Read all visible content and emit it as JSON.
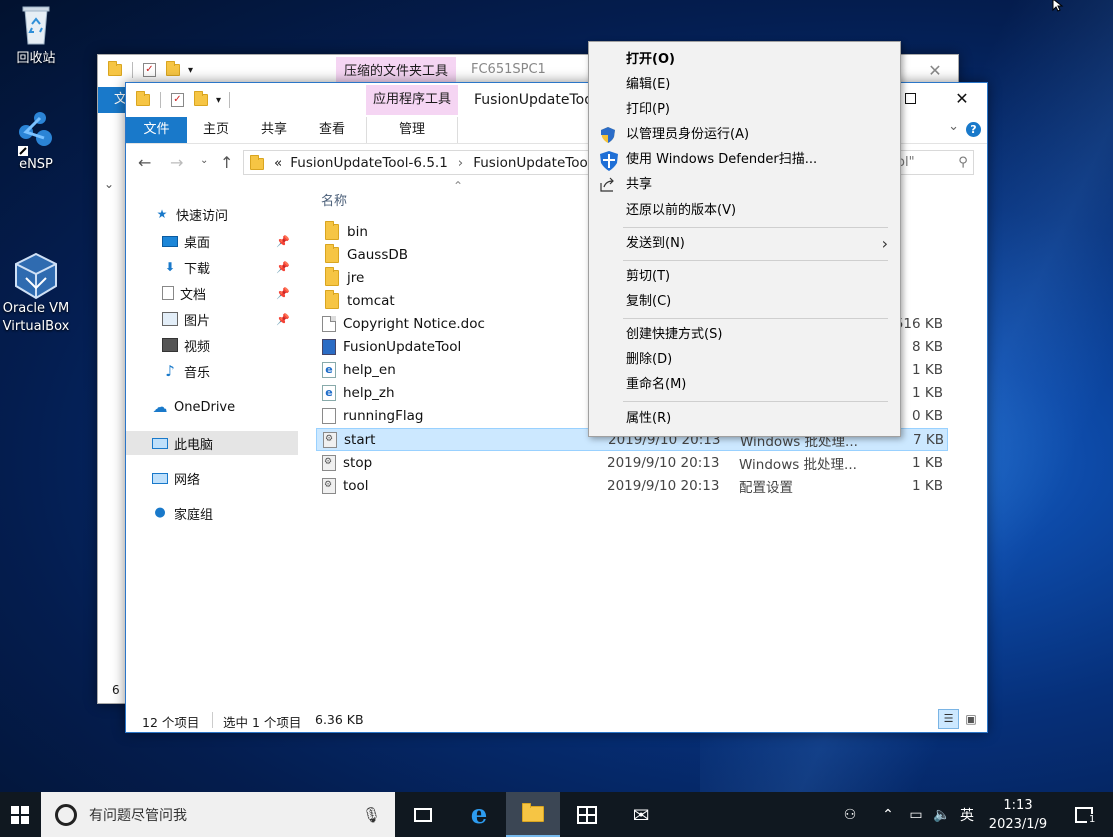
{
  "desktop": {
    "icons": [
      {
        "label": "回收站"
      },
      {
        "label": "eNSP"
      },
      {
        "label": "Oracle VM\nVirtualBox"
      }
    ]
  },
  "back_window": {
    "context_tab": "压缩的文件夹工具",
    "title": "FC651SPC1",
    "file_tab": "文",
    "status_left": "6"
  },
  "front_window": {
    "context_tab": "应用程序工具",
    "title": "FusionUpdateTool",
    "tabs": [
      "文件",
      "主页",
      "共享",
      "查看",
      "管理"
    ],
    "address": {
      "prefix": "«",
      "parts": [
        "FusionUpdateTool-6.5.1",
        "FusionUpdateTool"
      ],
      "separator": "›"
    },
    "search_placeholder": "ol\"",
    "column_name": "名称",
    "sidebar": [
      {
        "label": "快速访问",
        "icon": "star-icon"
      },
      {
        "label": "桌面",
        "icon": "desktop-icon",
        "pinned": true
      },
      {
        "label": "下载",
        "icon": "download-icon",
        "pinned": true
      },
      {
        "label": "文档",
        "icon": "document-icon",
        "pinned": true
      },
      {
        "label": "图片",
        "icon": "picture-icon",
        "pinned": true
      },
      {
        "label": "视频",
        "icon": "video-icon"
      },
      {
        "label": "音乐",
        "icon": "music-icon"
      },
      {
        "label": "OneDrive",
        "icon": "cloud-icon"
      },
      {
        "label": "此电脑",
        "icon": "computer-icon",
        "selected": true
      },
      {
        "label": "网络",
        "icon": "network-icon"
      },
      {
        "label": "家庭组",
        "icon": "homegroup-icon"
      }
    ],
    "files": [
      {
        "name": "bin",
        "kind": "folder",
        "date": "",
        "type": "",
        "size": ""
      },
      {
        "name": "GaussDB",
        "kind": "folder",
        "date": "",
        "type": "",
        "size": ""
      },
      {
        "name": "jre",
        "kind": "folder",
        "date": "",
        "type": "",
        "size": ""
      },
      {
        "name": "tomcat",
        "kind": "folder",
        "date": "",
        "type": "",
        "size": ""
      },
      {
        "name": "Copyright Notice.doc",
        "kind": "doc",
        "date": "",
        "type": "",
        "size": "516 KB"
      },
      {
        "name": "FusionUpdateTool",
        "kind": "app",
        "date": "",
        "type": "",
        "size": "8 KB"
      },
      {
        "name": "help_en",
        "kind": "html",
        "date": "",
        "type": "",
        "size": "1 KB"
      },
      {
        "name": "help_zh",
        "kind": "html",
        "date": "",
        "type": "",
        "size": "1 KB"
      },
      {
        "name": "runningFlag",
        "kind": "file",
        "date": "",
        "type": "",
        "size": "0 KB"
      },
      {
        "name": "start",
        "kind": "bat",
        "date": "2019/9/10 20:13",
        "type": "Windows 批处理...",
        "size": "7 KB",
        "selected": true
      },
      {
        "name": "stop",
        "kind": "bat",
        "date": "2019/9/10 20:13",
        "type": "Windows 批处理...",
        "size": "1 KB"
      },
      {
        "name": "tool",
        "kind": "config",
        "date": "2019/9/10 20:13",
        "type": "配置设置",
        "size": "1 KB"
      }
    ],
    "status": {
      "count": "12 个项目",
      "selected": "选中 1 个项目",
      "size": "6.36 KB"
    }
  },
  "context_menu": {
    "items": [
      {
        "label": "打开(O)",
        "bold": true
      },
      {
        "label": "编辑(E)"
      },
      {
        "label": "打印(P)"
      },
      {
        "label": "以管理员身份运行(A)",
        "icon": "uac-shield-icon"
      },
      {
        "label": "使用 Windows Defender扫描...",
        "icon": "defender-icon"
      },
      {
        "label": "共享",
        "icon": "share-icon"
      },
      {
        "label": "还原以前的版本(V)"
      },
      {
        "label": "发送到(N)",
        "submenu": true
      },
      {
        "label": "剪切(T)"
      },
      {
        "label": "复制(C)"
      },
      {
        "label": "创建快捷方式(S)"
      },
      {
        "label": "删除(D)"
      },
      {
        "label": "重命名(M)"
      },
      {
        "label": "属性(R)"
      }
    ]
  },
  "taskbar": {
    "search_placeholder": "有问题尽管问我",
    "ime": "英",
    "time": "1:13",
    "date": "2023/1/9",
    "notification_count": "1"
  },
  "colors": {
    "accent": "#1979ca",
    "selection": "#cce8ff",
    "ribbon_context_bg": "#f5d5f3"
  }
}
